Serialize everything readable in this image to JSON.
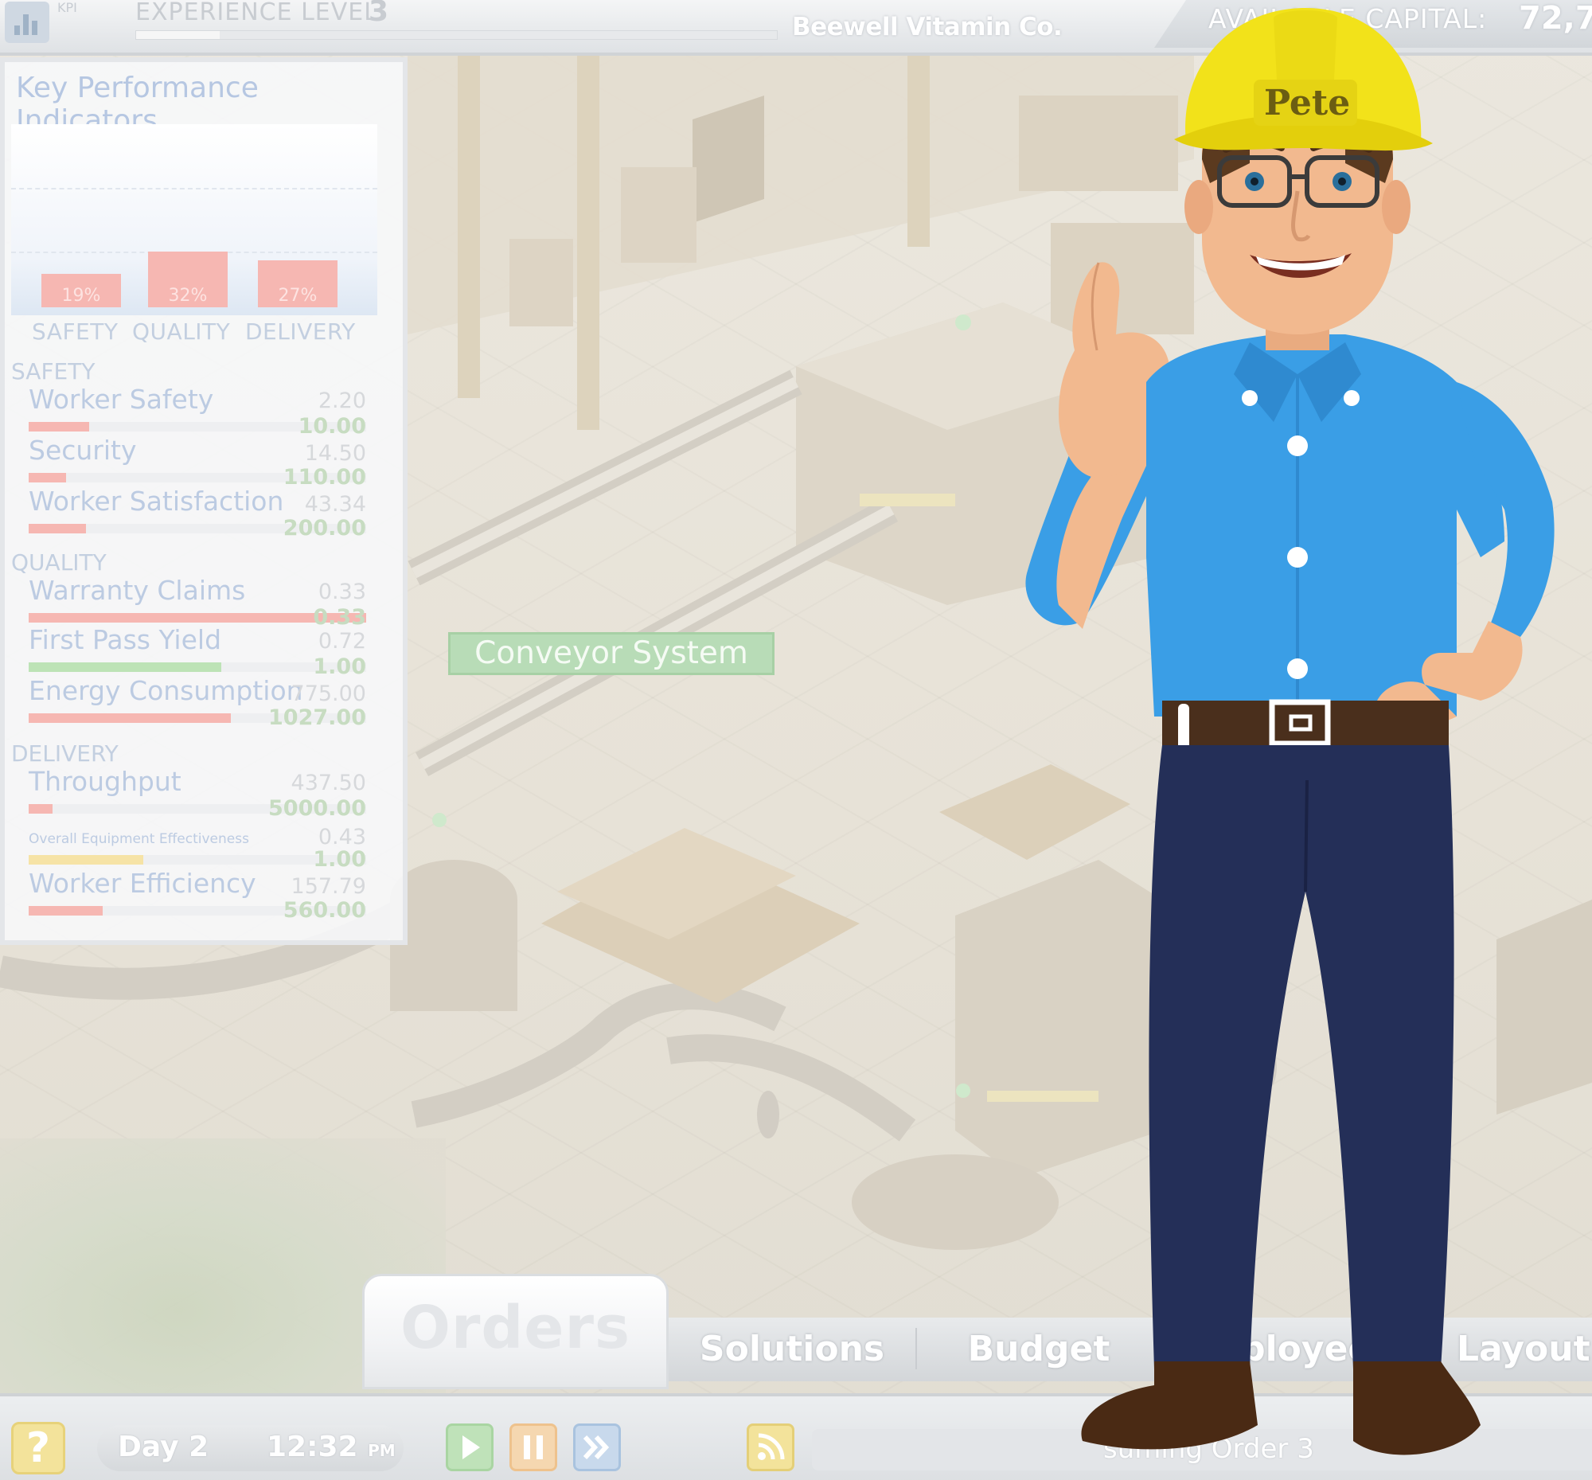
{
  "topbar": {
    "kpi_button_label": "KPI",
    "experience_label": "EXPERIENCE LEVEL",
    "experience_level": "3",
    "experience_progress": 0.13,
    "company_name": "Beewell Vitamin Co.",
    "capital_label": "AVAILABLE CAPITAL:",
    "capital_value": "72,7"
  },
  "kpi_panel": {
    "title": "Key Performance Indicators",
    "summary": [
      {
        "category": "SAFETY",
        "value": "19%",
        "percent": 19
      },
      {
        "category": "QUALITY",
        "value": "32%",
        "percent": 32
      },
      {
        "category": "DELIVERY",
        "value": "27%",
        "percent": 27
      }
    ],
    "sections": [
      {
        "label": "SAFETY",
        "metrics": [
          {
            "name": "Worker Safety",
            "value": "2.20",
            "target": "10.00",
            "fill": 0.18,
            "color": "#f6b7b2"
          },
          {
            "name": "Security",
            "value": "14.50",
            "target": "110.00",
            "fill": 0.11,
            "color": "#f6b7b2"
          },
          {
            "name": "Worker Satisfaction",
            "value": "43.34",
            "target": "200.00",
            "fill": 0.17,
            "color": "#f6b7b2"
          }
        ]
      },
      {
        "label": "QUALITY",
        "metrics": [
          {
            "name": "Warranty Claims",
            "value": "0.33",
            "target": "0.33",
            "fill": 1.0,
            "color": "#f6b7b2"
          },
          {
            "name": "First Pass Yield",
            "value": "0.72",
            "target": "1.00",
            "fill": 0.57,
            "color": "#bde3b6"
          },
          {
            "name": "Energy Consumption",
            "value": "775.00",
            "target": "1027.00",
            "fill": 0.6,
            "color": "#f6b7b2"
          }
        ]
      },
      {
        "label": "DELIVERY",
        "metrics": [
          {
            "name": "Throughput",
            "value": "437.50",
            "target": "5000.00",
            "fill": 0.07,
            "color": "#f6b7b2"
          },
          {
            "name": "Overall Equipment Effectiveness",
            "value": "0.43",
            "target": "1.00",
            "fill": 0.34,
            "color": "#f6e3a6"
          },
          {
            "name": "Worker Efficiency",
            "value": "157.79",
            "target": "560.00",
            "fill": 0.22,
            "color": "#f6b7b2"
          }
        ]
      }
    ]
  },
  "map": {
    "hover_label": "Conveyor System"
  },
  "tabs": {
    "orders": "Orders",
    "solutions": "Solutions",
    "budget": "Budget",
    "employees": "nployee",
    "layout": "Layout"
  },
  "status": {
    "help": "?",
    "day": "Day 2",
    "time": "12:32",
    "time_suffix": "PM",
    "ticker": "suming Order 3"
  },
  "character": {
    "helmet_name": "Pete"
  },
  "colors": {
    "play": "#bfe2b9",
    "pause": "#f5d7b0",
    "fast_forward": "#c8d9ec",
    "shirt": "#3a9ee6",
    "helmet": "#f2e21a",
    "pants": "#242f58"
  }
}
